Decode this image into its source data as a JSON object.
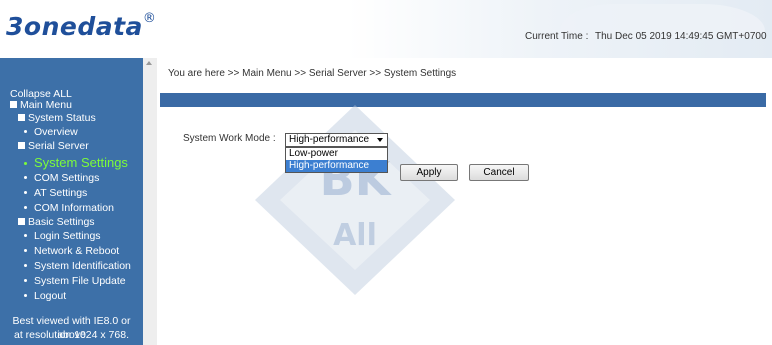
{
  "header": {
    "logo_text": "3onedata",
    "logo_mark": "®",
    "time_label": "Current Time :",
    "time_value": "Thu Dec 05 2019 14:49:45 GMT+0700"
  },
  "sidebar": {
    "collapse_all": "Collapse ALL",
    "main_menu": "Main Menu",
    "system_status": "System Status",
    "overview": "Overview",
    "serial_server": "Serial Server",
    "system_settings": "System Settings",
    "com_settings": "COM Settings",
    "at_settings": "AT Settings",
    "com_information": "COM Information",
    "basic_settings": "Basic Settings",
    "login_settings": "Login Settings",
    "network_reboot": "Network & Reboot",
    "system_identification": "System Identification",
    "system_file_update": "System File Update",
    "logout": "Logout",
    "footer_line1": "Best viewed with IE8.0 or above",
    "footer_line2": "at resolution 1024 x 768."
  },
  "main": {
    "breadcrumb": "You are here >> Main Menu >> Serial Server >> System Settings",
    "work_mode_label": "System Work Mode :",
    "work_mode_value": "High-performance",
    "work_mode_options": [
      "Low-power",
      "High-performance"
    ],
    "apply_label": "Apply",
    "cancel_label": "Cancel"
  },
  "watermark": {
    "text_top": "BK",
    "text_bottom": "All"
  },
  "colors": {
    "sidebar_bg": "#3d70a8",
    "active_item": "#7cfc3a",
    "accent_bar": "#3a6aa5",
    "logo": "#1f4f9a",
    "selected_option": "#3c7fd1"
  }
}
